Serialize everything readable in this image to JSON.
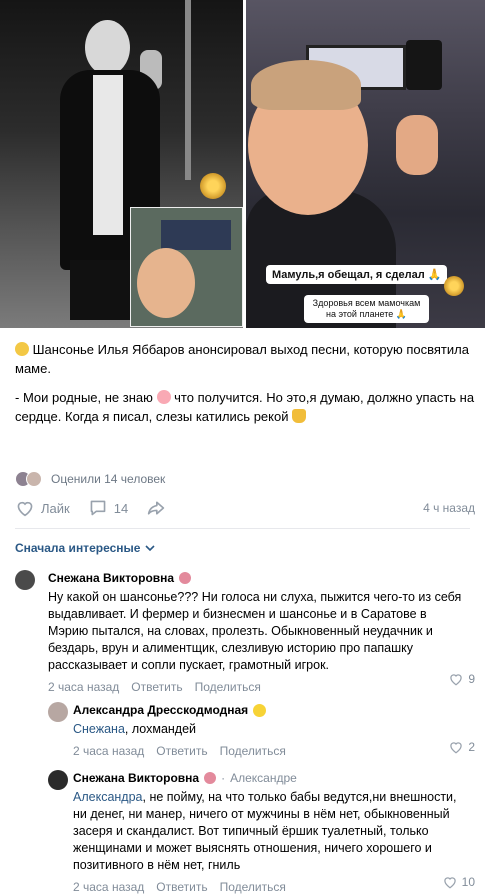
{
  "post": {
    "text_line1": "Шансонье Илья Яббаров анонсировал выход песни, которую посвятила маме.",
    "text_line2_before": "- Мои родные, не знаю",
    "text_line2_after": "что получится. Но это,я думаю, должно упасть на сердце. Когда я писал, слезы катились рекой",
    "story_caption_1": "Мамуль,я обещал, я сделал 🙏",
    "story_caption_2": "Здоровья всем мамочкам на этой планете 🙏"
  },
  "reactions": {
    "rated_text": "Оценили 14 человек",
    "like_label": "Лайк",
    "comments_count": "14",
    "time": "4 ч назад"
  },
  "comments_header": {
    "sort_label": "Сначала интересные"
  },
  "comments": [
    {
      "author": "Снежана Викторовна",
      "text": "Ну какой он шансонье??? Ни голоса ни слуха, пыжится чего-то из себя выдавливает. И фермер и бизнесмен и шансонье и в Саратове в Мэрию пытался, на словах, пролезть. Обыкновенный неудачник и бездарь, врун и алиментщик, слезливую историю про папашку рассказывает и сопли пускает, грамотный игрок.",
      "time": "2 часа назад",
      "reply_label": "Ответить",
      "share_label": "Поделиться",
      "likes": "9"
    },
    {
      "author": "Александра Дресскодмодная",
      "mention": "Снежана",
      "text": ", лохмандей",
      "time": "2 часа назад",
      "reply_label": "Ответить",
      "share_label": "Поделиться",
      "likes": "2"
    },
    {
      "author": "Снежана Викторовна",
      "reply_to": "Александре",
      "mention": "Александра",
      "text": ", не пойму, на что только бабы ведутся,ни внешности, ни денег, ни манер, ничего от мужчины в нём нет, обыкновенный засеря и скандалист. Вот типичный ёршик туалетный, только женщинами и может выяснять отношения, ничего хорошего и позитивного в нём нет, гниль",
      "time": "2 часа назад",
      "reply_label": "Ответить",
      "share_label": "Поделиться",
      "likes": "10"
    }
  ],
  "colors": {
    "link": "#2a5885",
    "muted": "#818c99",
    "divider": "#e7e8ec"
  }
}
